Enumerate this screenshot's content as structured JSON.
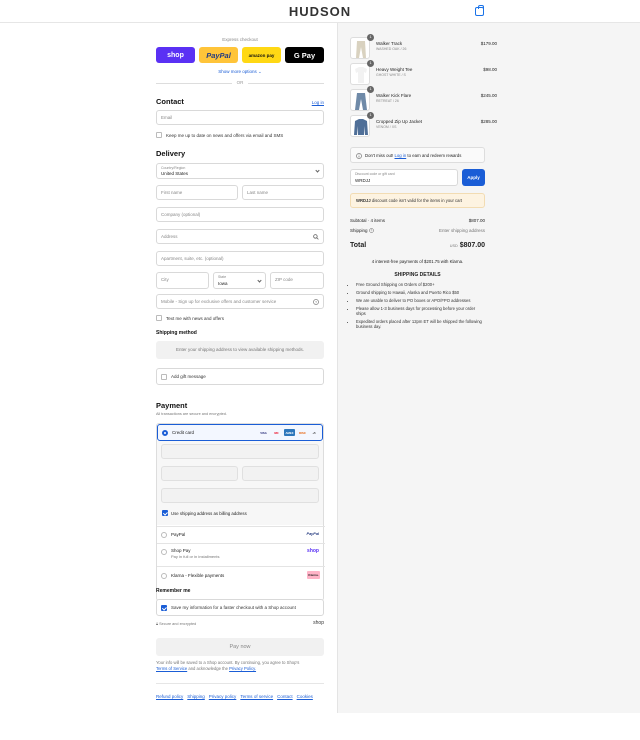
{
  "header": {
    "brand": "HUDSON",
    "cart_icon": "shopping-bag-icon"
  },
  "express": {
    "title": "Express checkout",
    "buttons": [
      {
        "label": "shop",
        "bg": "#5a31f4",
        "color": "#ffffff"
      },
      {
        "label": "PayPal",
        "bg": "#ffc439",
        "color": "#253b80"
      },
      {
        "label": "amazon pay",
        "bg": "#ffd814",
        "color": "#111111"
      },
      {
        "label": "G Pay",
        "bg": "#000000",
        "color": "#ffffff"
      }
    ],
    "show_more": "Show more options ⌄",
    "or": "OR"
  },
  "contact": {
    "heading": "Contact",
    "login": "Log in",
    "email_placeholder": "Email",
    "news_label": "Keep me up to date on news and offers via email and SMS"
  },
  "delivery": {
    "heading": "Delivery",
    "country_label": "Country/Region",
    "country_value": "United States",
    "first_name": "First name",
    "last_name": "Last name",
    "company": "Company (optional)",
    "address": "Address",
    "apartment": "Apartment, suite, etc. (optional)",
    "city": "City",
    "state_label": "State",
    "state_value": "Iowa",
    "zip": "ZIP code",
    "phone": "Mobile - Sign up for exclusive offers and customer service",
    "text_me": "Text me with news and offers"
  },
  "shipping_method": {
    "heading": "Shipping method",
    "notice": "Enter your shipping address to view available shipping methods."
  },
  "gift": {
    "label": "Add gift message"
  },
  "payment": {
    "heading": "Payment",
    "subtitle": "All transactions are secure and encrypted.",
    "credit_card": "Credit card",
    "card_icons": [
      "VISA",
      "MC",
      "AMEX",
      "DISC"
    ],
    "more_cards": "+5",
    "billing_label": "Use shipping address as billing address",
    "paypal": "PayPal",
    "paypal_badge": "PayPal",
    "shop_pay": "Shop Pay",
    "shop_pay_sub": "Pay in full or in installments",
    "shop_pay_badge": "shop",
    "klarna": "Klarna - Flexible payments",
    "klarna_badge": "Klarna."
  },
  "remember": {
    "heading": "Remember me",
    "save_label": "Save my information for a faster checkout with a Shop account",
    "secure": "Secure and encrypted",
    "shop_badge": "shop"
  },
  "pay_now": "Pay now",
  "legal": {
    "text": "Your info will be saved to a Shop account. By continuing, you agree to Shop's",
    "terms": "Terms of Service",
    "and": "and acknowledge the",
    "privacy": "Privacy Policy."
  },
  "footer_links": [
    "Refund policy",
    "Shipping",
    "Privacy policy",
    "Terms of service",
    "Contact",
    "Cookies"
  ],
  "cart": {
    "items": [
      {
        "name": "Walker Track",
        "variant": "WASHED OAK / 26",
        "price": "$179.00",
        "qty": "1",
        "color": "#d9d2c0"
      },
      {
        "name": "Heavy Weight Tee",
        "variant": "GHOST WHITE / S",
        "price": "$98.00",
        "qty": "1",
        "color": "#f2f2f2"
      },
      {
        "name": "Walker Kick Flare",
        "variant": "RETREAT / 26",
        "price": "$245.00",
        "qty": "1",
        "color": "#6f8aa8"
      },
      {
        "name": "Cropped Zip Up Jacket",
        "variant": "VENOM / XS",
        "price": "$285.00",
        "qty": "1",
        "color": "#4f6f98"
      }
    ],
    "rewards": "Don't miss out!",
    "rewards_link": "Log in",
    "rewards_rest": "to earn and redeem rewards",
    "discount_label": "Discount code or gift card",
    "discount_value": "WRDJJ",
    "apply": "Apply",
    "error_code": "WRDJJ",
    "error_text": "discount code isn't valid for the items in your cart",
    "subtotal_label": "Subtotal · 4 items",
    "subtotal_value": "$807.00",
    "shipping_label": "Shipping",
    "shipping_value": "Enter shipping address",
    "total_label": "Total",
    "currency": "USD",
    "total_value": "$807.00",
    "klarna_note": "4 interest-free payments of $201.75 with Klarna.",
    "ship_heading": "SHIPPING DETAILS",
    "ship_details": [
      "Free Ground Shipping on Orders of $200+",
      "Ground shipping to Hawaii, Alaska and Puerto Rico $50",
      "We are unable to deliver to PO boxes or APO/FPO addresses",
      "Please allow 1-3 business days for processing before your order ships",
      "Expedited orders placed after 12pm ET will be shipped the following business day."
    ]
  }
}
